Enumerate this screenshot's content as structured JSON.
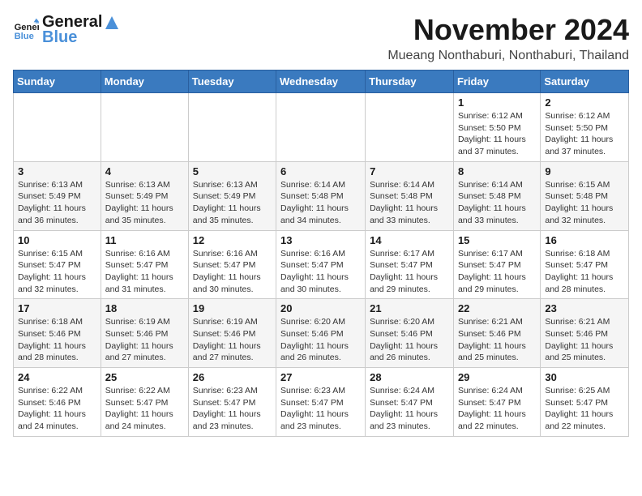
{
  "logo": {
    "line1": "General",
    "line2": "Blue"
  },
  "title": "November 2024",
  "subtitle": "Mueang Nonthaburi, Nonthaburi, Thailand",
  "weekdays": [
    "Sunday",
    "Monday",
    "Tuesday",
    "Wednesday",
    "Thursday",
    "Friday",
    "Saturday"
  ],
  "weeks": [
    [
      {
        "day": "",
        "info": ""
      },
      {
        "day": "",
        "info": ""
      },
      {
        "day": "",
        "info": ""
      },
      {
        "day": "",
        "info": ""
      },
      {
        "day": "",
        "info": ""
      },
      {
        "day": "1",
        "info": "Sunrise: 6:12 AM\nSunset: 5:50 PM\nDaylight: 11 hours\nand 37 minutes."
      },
      {
        "day": "2",
        "info": "Sunrise: 6:12 AM\nSunset: 5:50 PM\nDaylight: 11 hours\nand 37 minutes."
      }
    ],
    [
      {
        "day": "3",
        "info": "Sunrise: 6:13 AM\nSunset: 5:49 PM\nDaylight: 11 hours\nand 36 minutes."
      },
      {
        "day": "4",
        "info": "Sunrise: 6:13 AM\nSunset: 5:49 PM\nDaylight: 11 hours\nand 35 minutes."
      },
      {
        "day": "5",
        "info": "Sunrise: 6:13 AM\nSunset: 5:49 PM\nDaylight: 11 hours\nand 35 minutes."
      },
      {
        "day": "6",
        "info": "Sunrise: 6:14 AM\nSunset: 5:48 PM\nDaylight: 11 hours\nand 34 minutes."
      },
      {
        "day": "7",
        "info": "Sunrise: 6:14 AM\nSunset: 5:48 PM\nDaylight: 11 hours\nand 33 minutes."
      },
      {
        "day": "8",
        "info": "Sunrise: 6:14 AM\nSunset: 5:48 PM\nDaylight: 11 hours\nand 33 minutes."
      },
      {
        "day": "9",
        "info": "Sunrise: 6:15 AM\nSunset: 5:48 PM\nDaylight: 11 hours\nand 32 minutes."
      }
    ],
    [
      {
        "day": "10",
        "info": "Sunrise: 6:15 AM\nSunset: 5:47 PM\nDaylight: 11 hours\nand 32 minutes."
      },
      {
        "day": "11",
        "info": "Sunrise: 6:16 AM\nSunset: 5:47 PM\nDaylight: 11 hours\nand 31 minutes."
      },
      {
        "day": "12",
        "info": "Sunrise: 6:16 AM\nSunset: 5:47 PM\nDaylight: 11 hours\nand 30 minutes."
      },
      {
        "day": "13",
        "info": "Sunrise: 6:16 AM\nSunset: 5:47 PM\nDaylight: 11 hours\nand 30 minutes."
      },
      {
        "day": "14",
        "info": "Sunrise: 6:17 AM\nSunset: 5:47 PM\nDaylight: 11 hours\nand 29 minutes."
      },
      {
        "day": "15",
        "info": "Sunrise: 6:17 AM\nSunset: 5:47 PM\nDaylight: 11 hours\nand 29 minutes."
      },
      {
        "day": "16",
        "info": "Sunrise: 6:18 AM\nSunset: 5:47 PM\nDaylight: 11 hours\nand 28 minutes."
      }
    ],
    [
      {
        "day": "17",
        "info": "Sunrise: 6:18 AM\nSunset: 5:46 PM\nDaylight: 11 hours\nand 28 minutes."
      },
      {
        "day": "18",
        "info": "Sunrise: 6:19 AM\nSunset: 5:46 PM\nDaylight: 11 hours\nand 27 minutes."
      },
      {
        "day": "19",
        "info": "Sunrise: 6:19 AM\nSunset: 5:46 PM\nDaylight: 11 hours\nand 27 minutes."
      },
      {
        "day": "20",
        "info": "Sunrise: 6:20 AM\nSunset: 5:46 PM\nDaylight: 11 hours\nand 26 minutes."
      },
      {
        "day": "21",
        "info": "Sunrise: 6:20 AM\nSunset: 5:46 PM\nDaylight: 11 hours\nand 26 minutes."
      },
      {
        "day": "22",
        "info": "Sunrise: 6:21 AM\nSunset: 5:46 PM\nDaylight: 11 hours\nand 25 minutes."
      },
      {
        "day": "23",
        "info": "Sunrise: 6:21 AM\nSunset: 5:46 PM\nDaylight: 11 hours\nand 25 minutes."
      }
    ],
    [
      {
        "day": "24",
        "info": "Sunrise: 6:22 AM\nSunset: 5:46 PM\nDaylight: 11 hours\nand 24 minutes."
      },
      {
        "day": "25",
        "info": "Sunrise: 6:22 AM\nSunset: 5:47 PM\nDaylight: 11 hours\nand 24 minutes."
      },
      {
        "day": "26",
        "info": "Sunrise: 6:23 AM\nSunset: 5:47 PM\nDaylight: 11 hours\nand 23 minutes."
      },
      {
        "day": "27",
        "info": "Sunrise: 6:23 AM\nSunset: 5:47 PM\nDaylight: 11 hours\nand 23 minutes."
      },
      {
        "day": "28",
        "info": "Sunrise: 6:24 AM\nSunset: 5:47 PM\nDaylight: 11 hours\nand 23 minutes."
      },
      {
        "day": "29",
        "info": "Sunrise: 6:24 AM\nSunset: 5:47 PM\nDaylight: 11 hours\nand 22 minutes."
      },
      {
        "day": "30",
        "info": "Sunrise: 6:25 AM\nSunset: 5:47 PM\nDaylight: 11 hours\nand 22 minutes."
      }
    ]
  ]
}
